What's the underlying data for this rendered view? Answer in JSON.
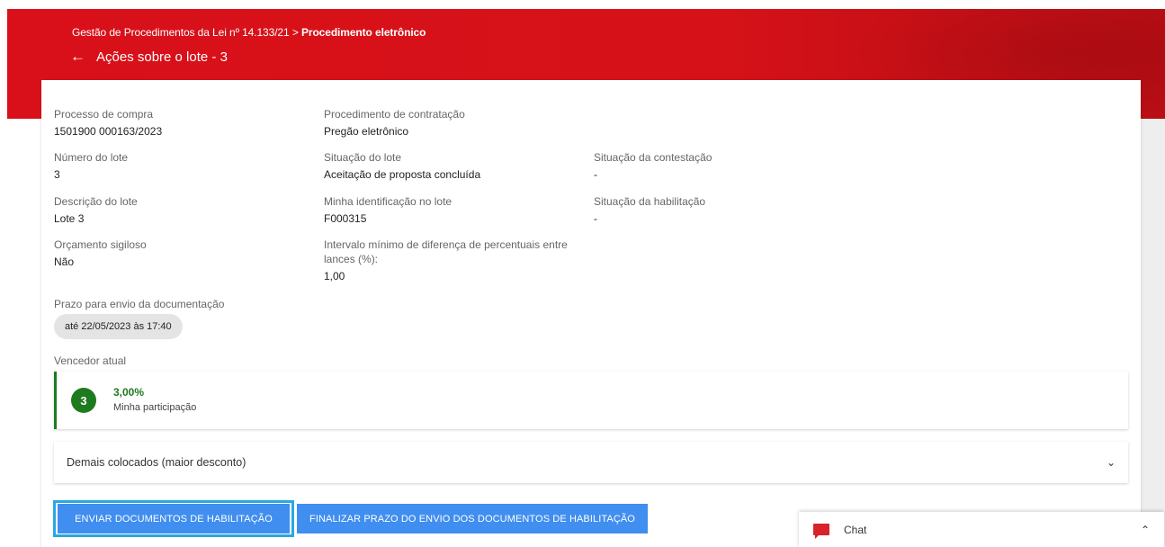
{
  "header": {
    "breadcrumb_prefix": "Gestão de Procedimentos da Lei nº 14.133/21 > ",
    "breadcrumb_current": "Procedimento eletrônico",
    "back_icon": "arrow-left-icon",
    "title": "Ações sobre o lote - 3"
  },
  "fields": {
    "processo": {
      "label": "Processo de compra",
      "value": "1501900 000163/2023"
    },
    "procedimento": {
      "label": "Procedimento de contratação",
      "value": "Pregão eletrônico"
    },
    "numero_lote": {
      "label": "Número do lote",
      "value": "3"
    },
    "situacao_lote": {
      "label": "Situação do lote",
      "value": "Aceitação de proposta concluída"
    },
    "situacao_contestacao": {
      "label": "Situação da contestação",
      "value": "-"
    },
    "descricao_lote": {
      "label": "Descrição do lote",
      "value": "Lote 3"
    },
    "minha_identificacao": {
      "label": "Minha identificação no lote",
      "value": "F000315"
    },
    "situacao_habilitacao": {
      "label": "Situação da habilitação",
      "value": "-"
    },
    "orcamento": {
      "label": "Orçamento sigiloso",
      "value": "Não"
    },
    "intervalo": {
      "label_line1": "Intervalo mínimo de diferença de percentuais entre",
      "label_line2": "lances (%):",
      "value": "1,00"
    }
  },
  "prazo": {
    "label": "Prazo para envio da documentação",
    "chip": "até 22/05/2023 às 17:40"
  },
  "vencedor": {
    "label": "Vencedor atual",
    "rank": "3",
    "percent": "3,00%",
    "participation": "Minha participação",
    "accent": "#1e7a1e"
  },
  "accordion": {
    "label": "Demais colocados (maior desconto)",
    "icon": "chevron-down-icon"
  },
  "buttons": {
    "enviar": "ENVIAR DOCUMENTOS DE HABILITAÇÃO",
    "finalizar": "FINALIZAR PRAZO DO ENVIO DOS DOCUMENTOS DE HABILITAÇÃO",
    "color": "#3f8ef0",
    "focus_color": "#29a8e0"
  },
  "chat": {
    "label": "Chat",
    "icon": "chat-bubble-icon",
    "toggle_icon": "chevron-up-icon"
  },
  "colors": {
    "header_red": "#d9101a"
  }
}
